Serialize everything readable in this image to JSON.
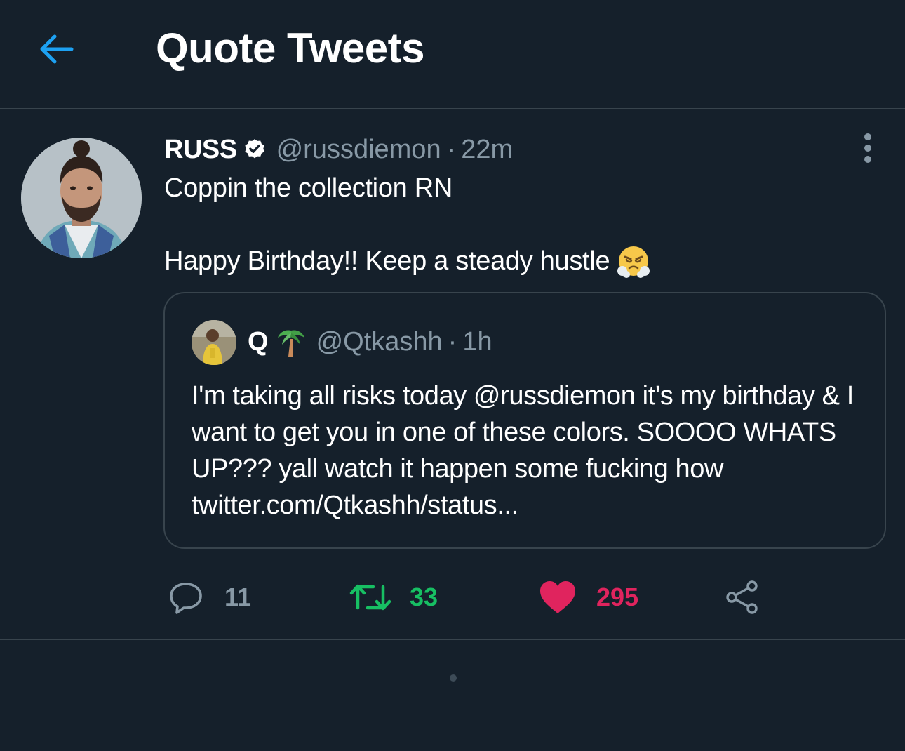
{
  "header": {
    "title": "Quote Tweets"
  },
  "tweet": {
    "author": {
      "display_name": "RUSS",
      "handle": "@russdiemon",
      "verified": true
    },
    "separator": "·",
    "time": "22m",
    "text_line1": "Coppin the collection RN",
    "text_line2": "Happy Birthday!! Keep a steady hustle",
    "emoji": "face-with-steam-from-nose",
    "quoted": {
      "display_name": "Q",
      "name_emoji": "palm-tree",
      "handle": "@Qtkashh",
      "separator": "·",
      "time": "1h",
      "text": "I'm taking all risks today @russdiemon it's my birthday & I want to get you in one of these colors. SOOOO WHATS UP??? yall watch it happen some fucking how twitter.com/Qtkashh/status..."
    },
    "actions": {
      "replies": "11",
      "retweets": "33",
      "likes": "295"
    }
  },
  "colors": {
    "background": "#15202b",
    "border": "#38444d",
    "secondary_text": "#8899a6",
    "accent": "#1da1f2",
    "retweet": "#17bf63",
    "like": "#e0245e"
  }
}
